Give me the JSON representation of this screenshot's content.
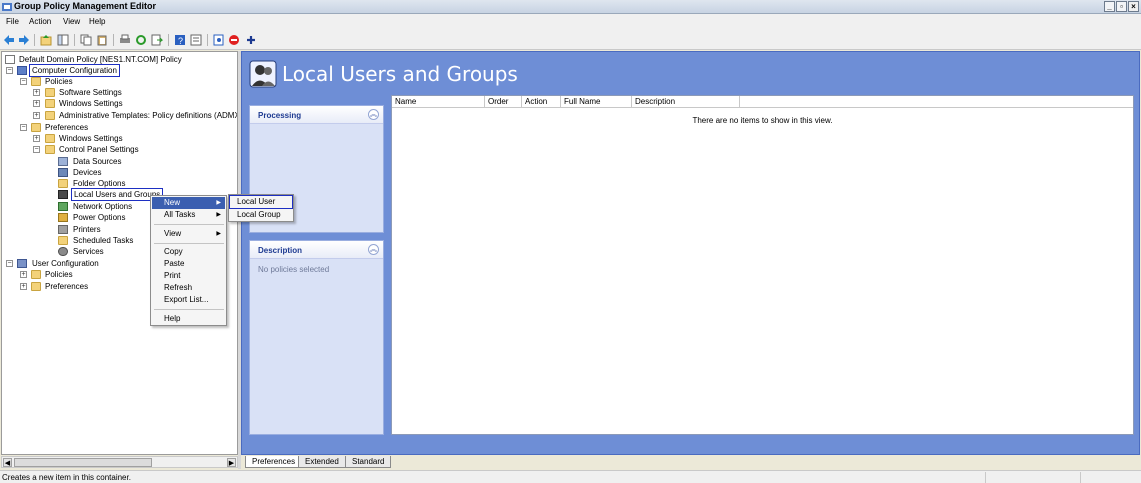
{
  "window": {
    "title": "Group Policy Management Editor"
  },
  "menubar": {
    "items": [
      "File",
      "Action",
      "View",
      "Help"
    ]
  },
  "tree": {
    "items": [
      {
        "label": "Default Domain Policy [NES1.NT.COM] Policy"
      },
      {
        "label": "Computer Configuration"
      },
      {
        "label": "Policies"
      },
      {
        "label": "Software Settings"
      },
      {
        "label": "Windows Settings"
      },
      {
        "label": "Administrative Templates: Policy definitions (ADMX f"
      },
      {
        "label": "Preferences"
      },
      {
        "label": "Windows Settings"
      },
      {
        "label": "Control Panel Settings"
      },
      {
        "label": "Data Sources"
      },
      {
        "label": "Devices"
      },
      {
        "label": "Folder Options"
      },
      {
        "label": "Local Users and Groups"
      },
      {
        "label": "Network Options"
      },
      {
        "label": "Power Options"
      },
      {
        "label": "Printers"
      },
      {
        "label": "Scheduled Tasks"
      },
      {
        "label": "Services"
      },
      {
        "label": "User Configuration"
      },
      {
        "label": "Policies"
      },
      {
        "label": "Preferences"
      }
    ]
  },
  "context_menu": {
    "items": [
      "New",
      "All Tasks",
      "View",
      "Copy",
      "Paste",
      "Print",
      "Refresh",
      "Export List...",
      "Help"
    ]
  },
  "submenu": {
    "items": [
      "Local User",
      "Local Group"
    ]
  },
  "right": {
    "title": "Local Users and Groups",
    "processing_title": "Processing",
    "description_title": "Description",
    "description_text": "No policies selected",
    "columns": [
      "Name",
      "Order",
      "Action",
      "Full Name",
      "Description"
    ],
    "empty_text": "There are no items to show in this view."
  },
  "tabs": [
    "Preferences",
    "Extended",
    "Standard"
  ],
  "status": {
    "text": "Creates a new item in this container."
  },
  "colors": {
    "highlight_outline": "#1d2fc2",
    "pane_blue": "#6e8ed6",
    "menu_selection": "#3b5fb0"
  }
}
